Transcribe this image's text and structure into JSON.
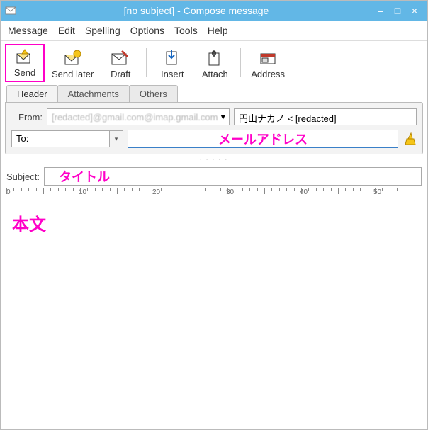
{
  "window": {
    "title": "[no subject] - Compose message"
  },
  "menu": {
    "message": "Message",
    "edit": "Edit",
    "spelling": "Spelling",
    "options": "Options",
    "tools": "Tools",
    "help": "Help"
  },
  "toolbar": {
    "send": "Send",
    "send_later": "Send later",
    "draft": "Draft",
    "insert": "Insert",
    "attach": "Attach",
    "address": "Address"
  },
  "tabs": {
    "header": "Header",
    "attachments": "Attachments",
    "others": "Others"
  },
  "form": {
    "from_label": "From:",
    "from_value": "[redacted]@gmail.com@imap.gmail.com",
    "name_value": "円山ナカノ < [redacted]",
    "to_label": "To:",
    "subject_label": "Subject:"
  },
  "ruler": {
    "marks": [
      "0",
      "10",
      "20",
      "30",
      "40",
      "50"
    ]
  },
  "annotations": {
    "mail_address": "メールアドレス",
    "title": "タイトル",
    "body": "本文"
  }
}
